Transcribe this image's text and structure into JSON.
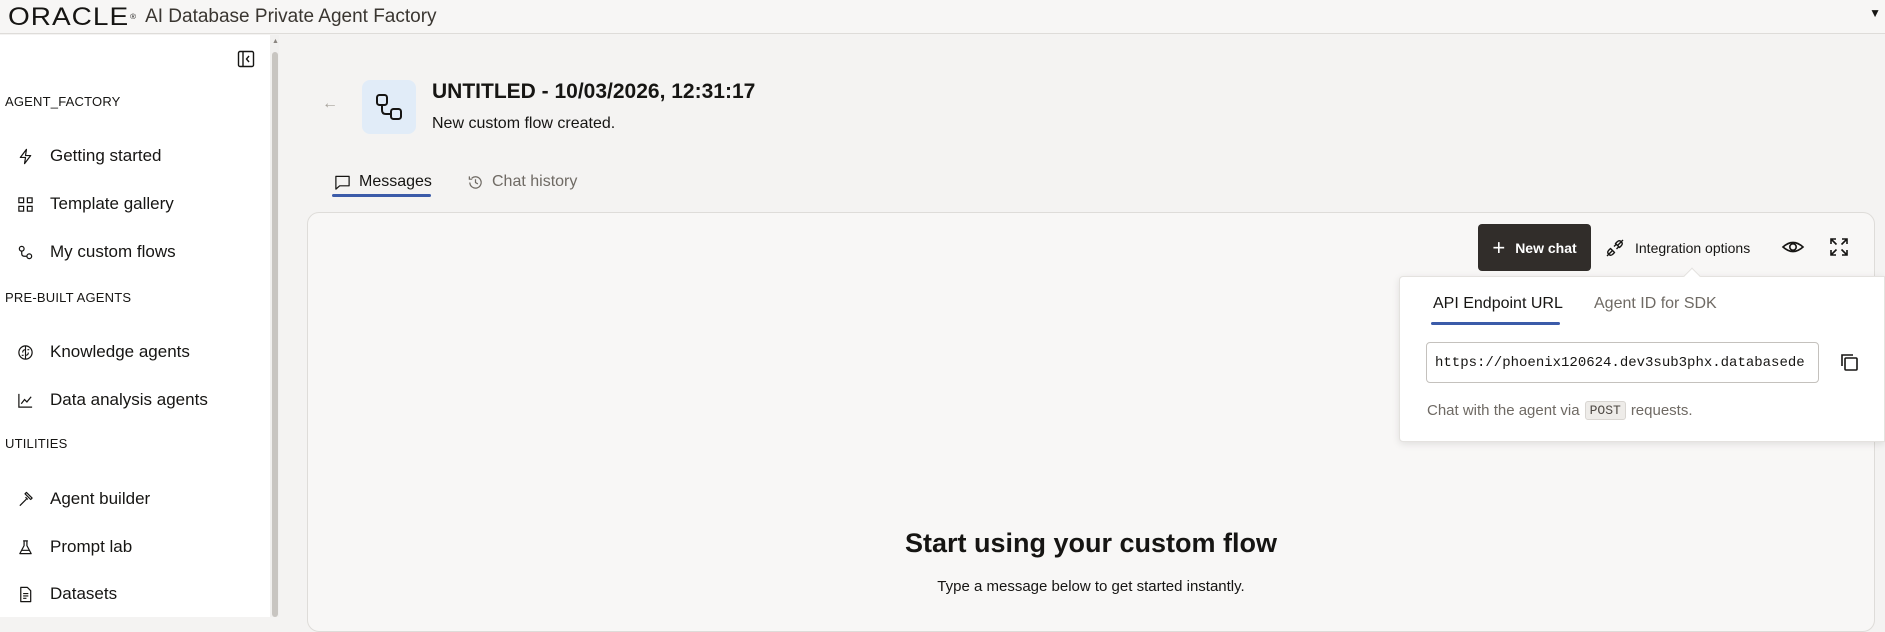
{
  "header": {
    "logo_text": "ORACLE",
    "app_title": "AI Database Private Agent Factory"
  },
  "sidebar": {
    "sections": [
      {
        "label": "AGENT_FACTORY",
        "items": [
          {
            "label": "Getting started",
            "icon": "bolt-icon"
          },
          {
            "label": "Template gallery",
            "icon": "grid-icon"
          },
          {
            "label": "My custom flows",
            "icon": "flow-icon"
          }
        ]
      },
      {
        "label": "PRE-BUILT AGENTS",
        "items": [
          {
            "label": "Knowledge agents",
            "icon": "brain-icon"
          },
          {
            "label": "Data analysis agents",
            "icon": "line-chart-icon"
          }
        ]
      },
      {
        "label": "UTILITIES",
        "items": [
          {
            "label": "Agent builder",
            "icon": "hammer-icon"
          },
          {
            "label": "Prompt lab",
            "icon": "flask-icon"
          },
          {
            "label": "Datasets",
            "icon": "document-icon"
          }
        ]
      }
    ]
  },
  "page": {
    "title": "UNTITLED - 10/03/2026, 12:31:17",
    "subtitle": "New custom flow created."
  },
  "tabs": [
    {
      "label": "Messages",
      "active": true
    },
    {
      "label": "Chat history",
      "active": false
    }
  ],
  "toolbar": {
    "new_chat_label": "New chat",
    "integration_label": "Integration options"
  },
  "integration_popover": {
    "tabs": [
      {
        "label": "API Endpoint URL",
        "active": true
      },
      {
        "label": "Agent ID for SDK",
        "active": false
      }
    ],
    "endpoint_url": "https://phoenix120624.dev3sub3phx.databasede",
    "help_prefix": "Chat with the agent via",
    "help_code": "POST",
    "help_suffix": "requests."
  },
  "empty_state": {
    "title": "Start using your custom flow",
    "subtitle": "Type a message below to get started instantly."
  },
  "colors": {
    "accent_blue": "#3b5ba9",
    "primary_button": "#312d2a",
    "icon_tile": "#e1ecf8"
  }
}
